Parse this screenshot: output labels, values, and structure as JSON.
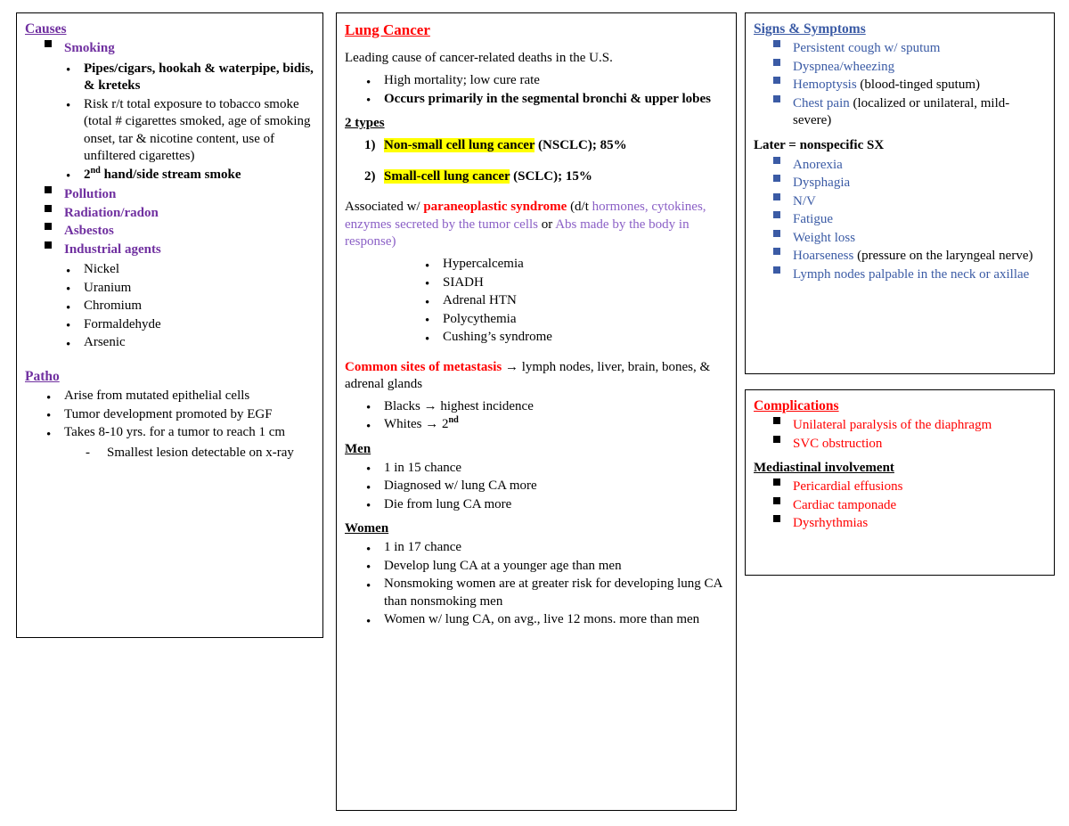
{
  "colors": {
    "purple": "#7030A0",
    "light_purple": "#8B60C6",
    "red": "#FF0000",
    "blue": "#3B5BA5",
    "highlight": "#FFFF00",
    "black": "#000000"
  },
  "causes_box": {
    "heading": "Causes",
    "smoking": {
      "label": "Smoking",
      "items": [
        "Pipes/cigars, hookah & waterpipe, bidis, & kreteks",
        "Risk r/t total exposure to tobacco smoke (total # cigarettes smoked, age of smoking onset, tar & nicotine content, use of unfiltered cigarettes)",
        "2nd hand/side stream smoke"
      ],
      "item3_prefix": "2",
      "item3_sup": "nd",
      "item3_rest": " hand/side stream smoke"
    },
    "other_causes": [
      "Pollution",
      "Radiation/radon",
      "Asbestos",
      "Industrial agents"
    ],
    "industrial_agents": [
      "Nickel",
      "Uranium",
      "Chromium",
      "Formaldehyde",
      "Arsenic"
    ],
    "patho": {
      "heading": "Patho ",
      "items": [
        "Arise from mutated epithelial cells",
        "Tumor development promoted by EGF",
        "Takes 8-10 yrs. for a tumor to reach 1 cm"
      ],
      "sub_item": "Smallest lesion detectable on x-ray"
    }
  },
  "lung_box": {
    "title": "Lung Cancer",
    "intro": "Leading cause of cancer-related deaths in the U.S.",
    "intro_bullets": [
      "High mortality; low cure rate",
      "Occurs primarily in the segmental bronchi & upper lobes"
    ],
    "types_heading": "2 types ",
    "types": [
      {
        "num": "1)",
        "highlight": "Non-small cell lung cancer",
        "rest": " (NSCLC); 85%"
      },
      {
        "num": "2)",
        "highlight": "Small-cell lung cancer",
        "rest": " (SCLC); 15%"
      }
    ],
    "assoc": {
      "lead": "Associated w/ ",
      "bold_red": "paraneoplastic syndrome",
      "paren_open": " (d/t ",
      "purple1": "hormones, cytokines, enzymes secreted by the tumor cells",
      "connector": " or ",
      "purple2": "Abs made by the body in response",
      "paren_close": ")"
    },
    "assoc_items": [
      "Hypercalcemia",
      "SIADH",
      "Adrenal HTN",
      "Polycythemia",
      "Cushing’s syndrome"
    ],
    "metastasis": {
      "red_label": "Common sites of metastasis",
      "rest": " lymph nodes, liver, brain, bones, & adrenal glands"
    },
    "incidence": [
      {
        "pre": "Blacks ",
        "post": " highest incidence",
        "sup": ""
      },
      {
        "pre": "Whites ",
        "post": " 2",
        "sup": "nd"
      }
    ],
    "men": {
      "heading": "Men ",
      "items": [
        "1 in 15 chance",
        "Diagnosed w/ lung CA more",
        "Die from lung CA more"
      ]
    },
    "women": {
      "heading": "Women",
      "items": [
        "1 in 17 chance",
        "Develop lung CA at a younger age than men",
        "Nonsmoking women are at greater risk for developing lung CA than nonsmoking men",
        "Women w/ lung CA, on avg., live 12 mons. more than men"
      ]
    }
  },
  "signs_box": {
    "heading": "Signs & Symptoms",
    "early": [
      {
        "blue": "Persistent cough w/ sputum",
        "black": ""
      },
      {
        "blue": "Dyspnea/wheezing",
        "black": ""
      },
      {
        "blue": "Hemoptysis",
        "black": " (blood-tinged sputum)"
      },
      {
        "blue": "Chest pain",
        "black": " (localized or unilateral, mild-severe)"
      }
    ],
    "later_heading": "Later = nonspecific SX",
    "later": [
      {
        "blue": "Anorexia",
        "black": ""
      },
      {
        "blue": "Dysphagia",
        "black": ""
      },
      {
        "blue": "N/V",
        "black": ""
      },
      {
        "blue": "Fatigue",
        "black": ""
      },
      {
        "blue": "Weight loss",
        "black": ""
      },
      {
        "blue": "Hoarseness",
        "black": " (pressure on the laryngeal nerve)"
      },
      {
        "blue": "Lymph nodes palpable in the neck or axillae",
        "black": ""
      }
    ]
  },
  "complications_box": {
    "heading": "Complications",
    "items": [
      "Unilateral paralysis of the diaphragm",
      "SVC obstruction"
    ],
    "mediastinal_heading": "Mediastinal involvement",
    "mediastinal_items": [
      "Pericardial effusions",
      "Cardiac tamponade",
      "Dysrhythmias"
    ]
  }
}
